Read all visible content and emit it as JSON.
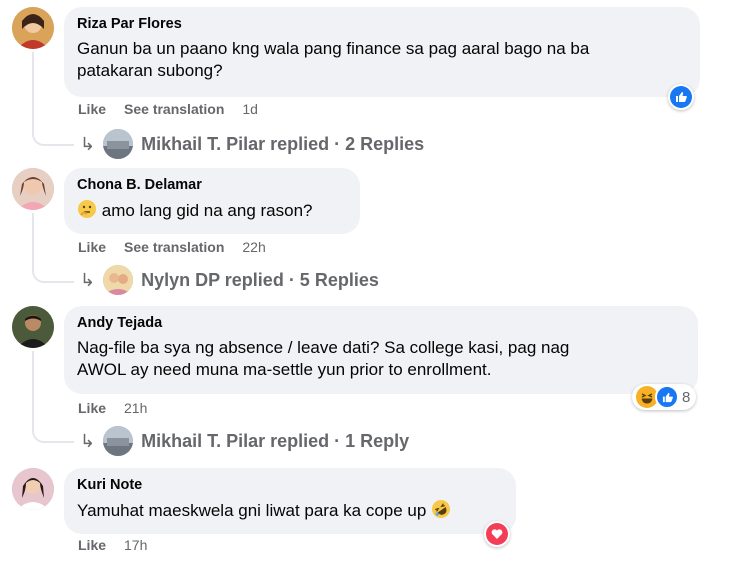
{
  "comments": [
    {
      "author": "Riza Par Flores",
      "text_line1": "Ganun ba un paano kng wala pang finance sa pag aaral bago na ba",
      "text_line2": "patakaran subong?",
      "like_label": "Like",
      "translate_label": "See translation",
      "time": "1d",
      "reply_author": "Mikhail T. Pilar replied",
      "reply_count": "· 2 Replies",
      "reactions": [
        "like-icon"
      ]
    },
    {
      "author": "Chona B. Delamar",
      "text": "amo lang gid na ang rason?",
      "text_emoji": "thinking-face-emoji",
      "like_label": "Like",
      "translate_label": "See translation",
      "time": "22h",
      "reply_author": "Nylyn DP replied",
      "reply_count": "· 5 Replies"
    },
    {
      "author": "Andy Tejada",
      "text_line1": "Nag-file ba sya ng absence / leave dati? Sa college kasi, pag nag",
      "text_line2": "AWOL ay need muna ma-settle yun prior to enrollment.",
      "like_label": "Like",
      "time": "21h",
      "reply_author": "Mikhail T. Pilar replied",
      "reply_count": "· 1 Reply",
      "reactions": [
        "haha-icon",
        "like-icon"
      ],
      "reaction_count": "8"
    },
    {
      "author": "Kuri Note",
      "text": "Yamuhat maeskwela gni liwat para ka cope up",
      "text_emoji": "rolling-laughing-emoji",
      "like_label": "Like",
      "time": "17h",
      "reactions": [
        "love-icon"
      ]
    }
  ],
  "colors": {
    "bubble": "#f0f2f5",
    "secondary_text": "#65676b",
    "like_blue": "#1877f2",
    "love_red": "#f33e58",
    "haha_yellow": "#f7b125"
  }
}
